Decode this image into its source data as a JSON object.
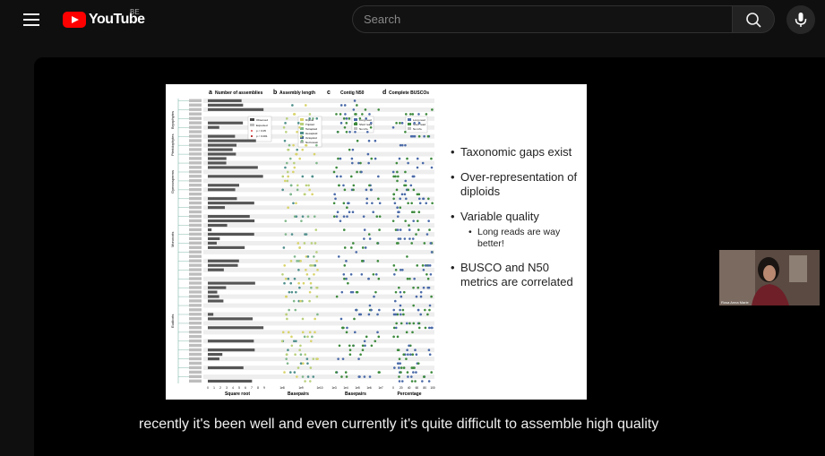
{
  "header": {
    "logo_text": "YouTube",
    "country_code": "BE",
    "search_placeholder": "Search",
    "colors": {
      "brand": "#ff0000",
      "background": "#0f0f0f"
    }
  },
  "video": {
    "slide": {
      "bullets": [
        {
          "text": "Taxonomic gaps exist",
          "sub": []
        },
        {
          "text": "Over-representation of diploids",
          "sub": []
        },
        {
          "text": "Variable quality",
          "sub": [
            "Long reads are way better!"
          ]
        },
        {
          "text": "BUSCO and N50 metrics are correlated",
          "sub": []
        }
      ],
      "figure": {
        "panels": [
          {
            "letter": "a",
            "title": "Number of assemblies",
            "axis_ticks": [
              "0",
              "1",
              "2",
              "3",
              "4",
              "5",
              "6",
              "7",
              "8",
              "9"
            ],
            "axis_label": "Square root",
            "legend": [
              "Observed",
              "Expected",
              "p < 0.05",
              "p < 0.001"
            ]
          },
          {
            "letter": "b",
            "title": "Assembly length",
            "axis_ticks": [
              "1e8",
              "1e9",
              "1e10"
            ],
            "axis_label": "Basepairs",
            "legend": [
              "Diploid",
              "Triploid",
              "Tetraploid",
              "Hexaploid",
              "Octoploid",
              "Not known"
            ]
          },
          {
            "letter": "c",
            "title": "Contig N50",
            "axis_ticks": [
              "1e3",
              "1e4",
              "1e5",
              "1e6",
              "1e7"
            ],
            "axis_label": "Basepairs",
            "legend": [
              "Long read",
              "Short read",
              "No info."
            ]
          },
          {
            "letter": "d",
            "title": "Complete BUSCOs",
            "axis_ticks": [
              "0",
              "20",
              "40",
              "60",
              "80",
              "100"
            ],
            "axis_label": "Percentage",
            "legend": [
              "Long read",
              "Short read",
              "No info."
            ]
          }
        ],
        "clade_labels": [
          "Bryophytes",
          "Pteridophytes",
          "Gymnosperms",
          "Monocots",
          "Eudicots"
        ]
      }
    },
    "captions": "recently it's been well and even currently it's quite difficult to assemble high quality",
    "webcam_name": "Rosa Anna Marie"
  }
}
